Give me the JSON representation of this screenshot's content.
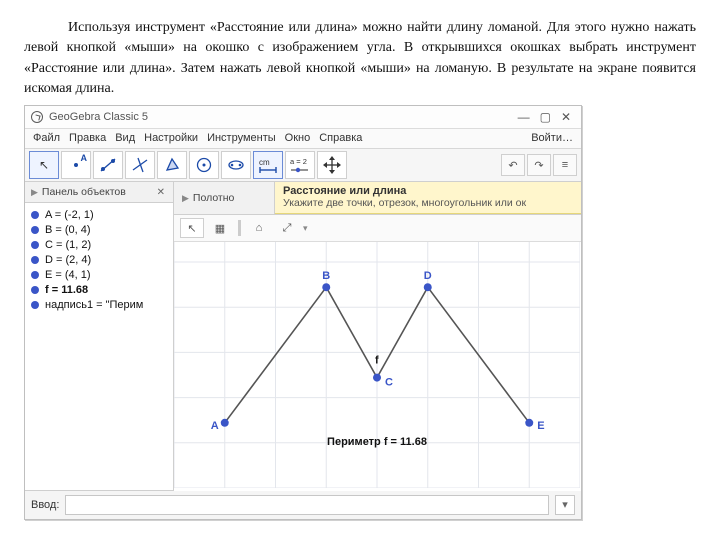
{
  "paragraph": "Используя инструмент «Расстояние или длина» можно найти длину ломаной. Для этого нужно нажать левой кнопкой «мыши» на окошко с изображением угла. В открывшихся окошках выбрать инструмент «Расстояние или длина». Затем нажать левой кнопкой «мыши» на ломаную. В результате на экране появится искомая длина.",
  "window": {
    "title": "GeoGebra Classic 5",
    "min": "—",
    "max": "▢",
    "close": "✕"
  },
  "menu": {
    "items": [
      "Файл",
      "Правка",
      "Вид",
      "Настройки",
      "Инструменты",
      "Окно",
      "Справка"
    ],
    "signin": "Войти…"
  },
  "toolbar": {
    "tools": [
      {
        "name": "move-tool",
        "kind": "arrow",
        "selected": true
      },
      {
        "name": "point-tool",
        "kind": "point"
      },
      {
        "name": "line-tool",
        "kind": "line"
      },
      {
        "name": "perpendicular-tool",
        "kind": "perp"
      },
      {
        "name": "polygon-tool",
        "kind": "poly"
      },
      {
        "name": "circle-tool",
        "kind": "circle"
      },
      {
        "name": "conic-tool",
        "kind": "conic"
      },
      {
        "name": "angle-tool",
        "kind": "angle",
        "selected": true
      },
      {
        "name": "slider-tool",
        "kind": "slider"
      },
      {
        "name": "move-view-tool",
        "kind": "moveview"
      }
    ],
    "right": [
      "↶",
      "↷",
      "≡"
    ]
  },
  "sidebar": {
    "header": "Панель объектов",
    "close": "✕",
    "objects": [
      {
        "label": "A = (-2, 1)"
      },
      {
        "label": "B = (0, 4)"
      },
      {
        "label": "C = (1, 2)"
      },
      {
        "label": "D = (2, 4)"
      },
      {
        "label": "E = (4, 1)"
      },
      {
        "label": "f = 11.68",
        "selected": true
      },
      {
        "label": "надпись1 = \"Перим"
      }
    ]
  },
  "canvas": {
    "title": "Полотно",
    "tooltip": {
      "title": "Расстояние или длина",
      "desc": "Укажите две точки, отрезок, многоугольник или ок"
    },
    "tb": {
      "ptr": "↖",
      "grid": "▦",
      "home": "⌂",
      "zoom": "⤢"
    },
    "f_label": "f",
    "caption": "Периметр f = 11.68"
  },
  "input": {
    "label": "Ввод:"
  },
  "chart_data": {
    "type": "line",
    "title": "Периметр f = 11.68",
    "xlabel": "",
    "ylabel": "",
    "series": [
      {
        "name": "f",
        "points": [
          {
            "label": "A",
            "x": -2,
            "y": 1
          },
          {
            "label": "B",
            "x": 0,
            "y": 4
          },
          {
            "label": "C",
            "x": 1,
            "y": 2
          },
          {
            "label": "D",
            "x": 2,
            "y": 4
          },
          {
            "label": "E",
            "x": 4,
            "y": 1
          }
        ]
      }
    ],
    "perimeter": 11.68,
    "xlim": [
      -3,
      5
    ],
    "ylim": [
      0,
      5
    ]
  }
}
